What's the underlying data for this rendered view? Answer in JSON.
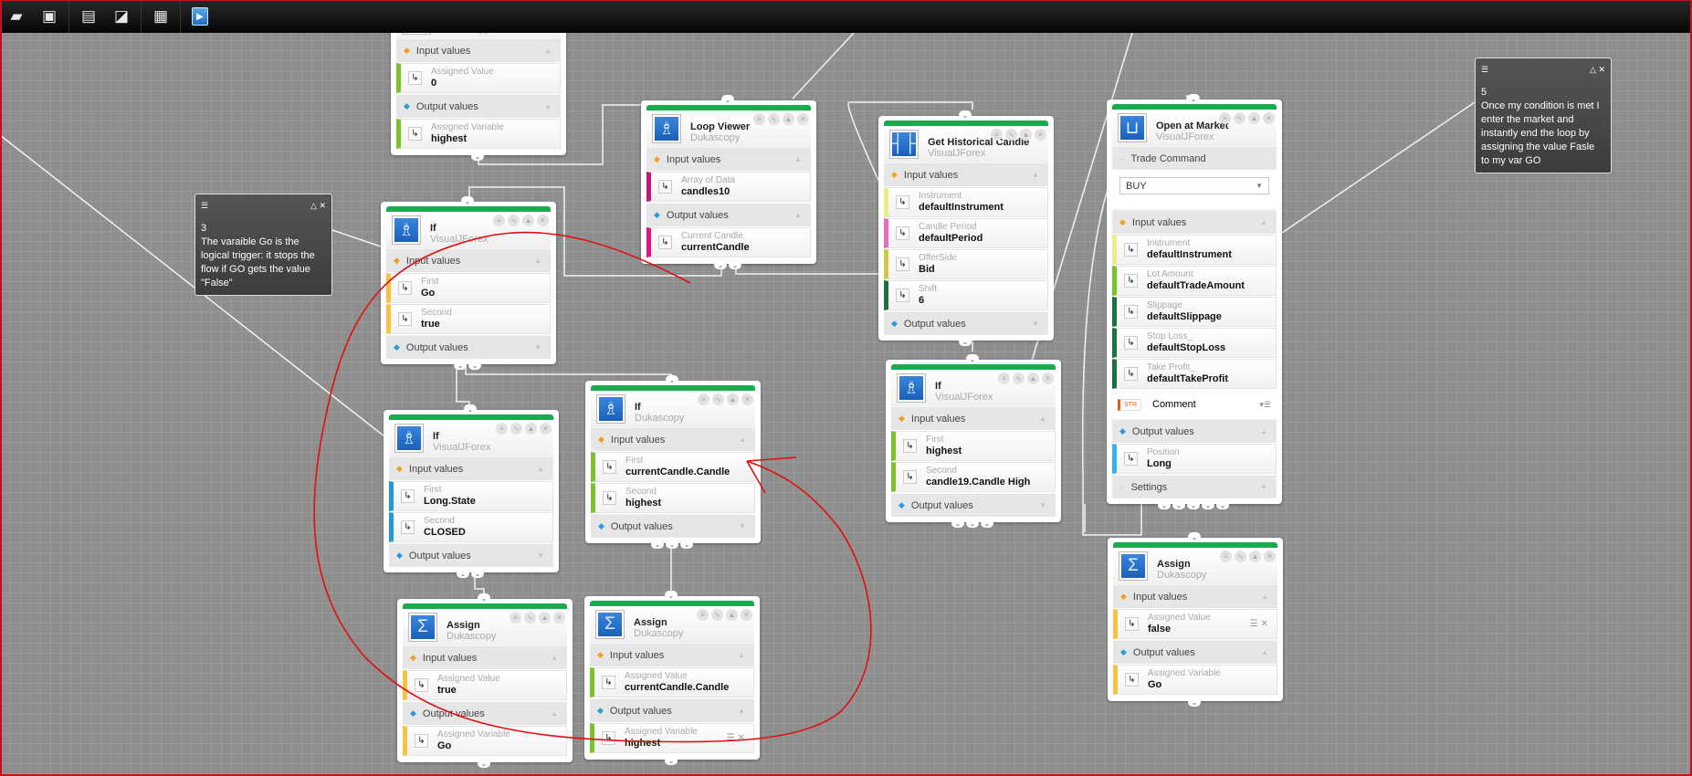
{
  "toolbar": {
    "buttons": [
      {
        "name": "open-folder-icon",
        "glyph": "▰"
      },
      {
        "name": "save-icon",
        "glyph": "▣"
      },
      {
        "name": "document-list-icon",
        "glyph": "▤"
      },
      {
        "name": "import-icon",
        "glyph": "◪"
      },
      {
        "name": "new-document-icon",
        "glyph": "▦"
      },
      {
        "name": "run-icon",
        "glyph": "▶"
      }
    ]
  },
  "colors": {
    "node_bar": "#1aab4f",
    "ink": "#e01010",
    "canvas": "#8e8e8e"
  },
  "notes": [
    {
      "number": "3",
      "text": "The varaible Go is the logical trigger: it stops the flow if GO gets the value \"False\""
    },
    {
      "number": "5",
      "text": "Once my condition is met I enter the market and instantly end the loop by assigning the value Fasle to my var GO"
    }
  ],
  "nodes": [
    {
      "title": "Assign",
      "subtitle": "Dukascopy",
      "icon": "sigma-icon",
      "sections": [
        {
          "type": "input",
          "label": "Input values",
          "open": true,
          "rows": [
            {
              "label": "Assigned Value",
              "value": "0",
              "color": "#7cc22d"
            }
          ]
        },
        {
          "type": "output",
          "label": "Output values",
          "open": true,
          "rows": [
            {
              "label": "Assigned Variable",
              "value": "highest",
              "color": "#7cc22d"
            }
          ]
        }
      ]
    },
    {
      "title": "Loop Viewer",
      "subtitle": "Dukascopy",
      "icon": "chess-piece-icon",
      "sections": [
        {
          "type": "input",
          "label": "Input values",
          "open": true,
          "rows": [
            {
              "label": "Array of Data",
              "value": "candles10",
              "color": "#c2187a"
            }
          ]
        },
        {
          "type": "output",
          "label": "Output values",
          "open": true,
          "rows": [
            {
              "label": "Current Candle",
              "value": "currentCandle",
              "color": "#e0147f"
            }
          ]
        }
      ]
    },
    {
      "title": "Get Historical Candle",
      "subtitle": "VisualJForex",
      "icon": "candle-icon",
      "sections": [
        {
          "type": "input",
          "label": "Input values",
          "open": true,
          "rows": [
            {
              "label": "Instrument",
              "value": "defaultInstrument",
              "color": "#eeec8a"
            },
            {
              "label": "Candle Period",
              "value": "defaultPeriod",
              "color": "#e86cc0"
            },
            {
              "label": "OfferSide",
              "value": "Bid",
              "color": "#cccc44"
            },
            {
              "label": "Shift",
              "value": "6",
              "color": "#1f6f40"
            }
          ]
        },
        {
          "type": "output",
          "label": "Output values",
          "open": false,
          "rows": []
        }
      ]
    },
    {
      "title": "Open at Market",
      "subtitle": "VisualJForex",
      "icon": "basket-icon",
      "trade_command": {
        "label": "Trade Command",
        "value": "BUY"
      },
      "comment": {
        "badge": "STR",
        "label": "Comment"
      },
      "sections": [
        {
          "type": "input",
          "label": "Input values",
          "open": true,
          "rows": [
            {
              "label": "Instrument",
              "value": "defaultInstrument",
              "color": "#eeec8a"
            },
            {
              "label": "Lot Amount",
              "value": "defaultTradeAmount",
              "color": "#7cc22d"
            },
            {
              "label": "Slippage",
              "value": "defaultSlippage",
              "color": "#1f6f40"
            },
            {
              "label": "Stop Loss_",
              "value": "defaultStopLoss",
              "color": "#1f6f40"
            },
            {
              "label": "Take Profit_",
              "value": "defaultTakeProfit",
              "color": "#1f6f40"
            }
          ]
        },
        {
          "type": "output",
          "label": "Output values",
          "open": true,
          "rows": [
            {
              "label": "Position",
              "value": "Long",
              "color": "#3ab4e6"
            }
          ]
        },
        {
          "type": "plain",
          "label": "Settings",
          "open": false,
          "rows": []
        }
      ]
    },
    {
      "title": "If",
      "subtitle": "VisualJForex",
      "icon": "chess-piece-icon",
      "sections": [
        {
          "type": "input",
          "label": "Input values",
          "open": true,
          "rows": [
            {
              "label": "First",
              "value": "Go",
              "color": "#f5c542"
            },
            {
              "label": "Second",
              "value": "true",
              "color": "#f5c542"
            }
          ]
        },
        {
          "type": "output",
          "label": "Output values",
          "open": false,
          "rows": []
        }
      ]
    },
    {
      "title": "If",
      "subtitle": "Dukascopy",
      "icon": "chess-piece-icon",
      "sections": [
        {
          "type": "input",
          "label": "Input values",
          "open": true,
          "rows": [
            {
              "label": "First",
              "value": "currentCandle.Candle Hig",
              "color": "#7cc22d"
            },
            {
              "label": "Second",
              "value": "highest",
              "color": "#7cc22d"
            }
          ]
        },
        {
          "type": "output",
          "label": "Output values",
          "open": false,
          "rows": []
        }
      ]
    },
    {
      "title": "If",
      "subtitle": "VisualJForex",
      "icon": "chess-piece-icon",
      "sections": [
        {
          "type": "input",
          "label": "Input values",
          "open": true,
          "rows": [
            {
              "label": "First",
              "value": "highest",
              "color": "#7cc22d"
            },
            {
              "label": "Second",
              "value": "candle19.Candle High",
              "color": "#7cc22d"
            }
          ]
        },
        {
          "type": "output",
          "label": "Output values",
          "open": false,
          "rows": []
        }
      ]
    },
    {
      "title": "If",
      "subtitle": "VisualJForex",
      "icon": "chess-piece-icon",
      "sections": [
        {
          "type": "input",
          "label": "Input values",
          "open": true,
          "rows": [
            {
              "label": "First",
              "value": "Long.State",
              "color": "#1e9ad6"
            },
            {
              "label": "Second",
              "value": "CLOSED",
              "color": "#1e9ad6"
            }
          ]
        },
        {
          "type": "output",
          "label": "Output values",
          "open": false,
          "rows": []
        }
      ]
    },
    {
      "title": "Assign",
      "subtitle": "Dukascopy",
      "icon": "sigma-icon",
      "sections": [
        {
          "type": "input",
          "label": "Input values",
          "open": true,
          "rows": [
            {
              "label": "Assigned Value",
              "value": "true",
              "color": "#f5c542"
            }
          ]
        },
        {
          "type": "output",
          "label": "Output values",
          "open": true,
          "rows": [
            {
              "label": "Assigned Variable",
              "value": "Go",
              "color": "#f5c542"
            }
          ]
        }
      ]
    },
    {
      "title": "Assign",
      "subtitle": "Dukascopy",
      "icon": "sigma-icon",
      "sections": [
        {
          "type": "input",
          "label": "Input values",
          "open": true,
          "rows": [
            {
              "label": "Assigned Value",
              "value": "currentCandle.Candle Hig",
              "color": "#7cc22d"
            }
          ]
        },
        {
          "type": "output",
          "label": "Output values",
          "open": true,
          "rows": [
            {
              "label": "Assigned Variable",
              "value": "highest",
              "color": "#7cc22d",
              "actions": true
            }
          ]
        }
      ]
    },
    {
      "title": "Assign",
      "subtitle": "Dukascopy",
      "icon": "sigma-icon",
      "sections": [
        {
          "type": "input",
          "label": "Input values",
          "open": true,
          "rows": [
            {
              "label": "Assigned Value",
              "value": "false",
              "color": "#f5c542",
              "actions": true
            }
          ]
        },
        {
          "type": "output",
          "label": "Output values",
          "open": true,
          "rows": [
            {
              "label": "Assigned Variable",
              "value": "Go",
              "color": "#f5c542"
            }
          ]
        }
      ]
    }
  ]
}
